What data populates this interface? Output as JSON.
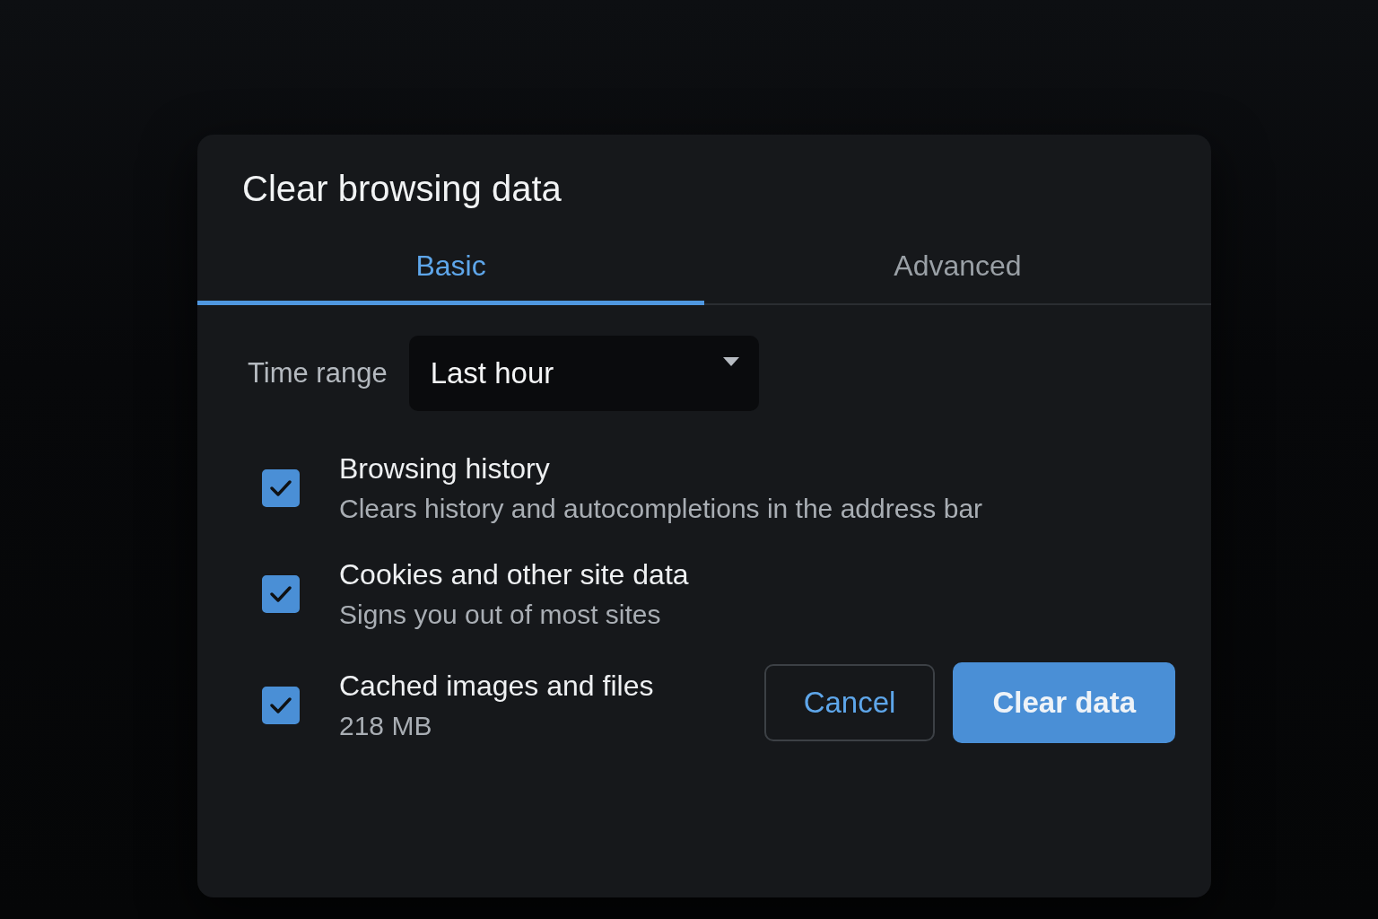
{
  "dialog": {
    "title": "Clear browsing data",
    "tabs": [
      {
        "label": "Basic",
        "selected": true
      },
      {
        "label": "Advanced",
        "selected": false
      }
    ],
    "time_range": {
      "label": "Time range",
      "value": "Last hour"
    },
    "options": [
      {
        "title": "Browsing history",
        "description": "Clears history and autocompletions in the address bar",
        "checked": true
      },
      {
        "title": "Cookies and other site data",
        "description": "Signs you out of most sites",
        "checked": true
      },
      {
        "title": "Cached images and files",
        "description": "218 MB",
        "checked": true
      }
    ],
    "buttons": [
      {
        "label": "Cancel",
        "kind": "secondary"
      },
      {
        "label": "Clear data",
        "kind": "primary"
      }
    ]
  }
}
